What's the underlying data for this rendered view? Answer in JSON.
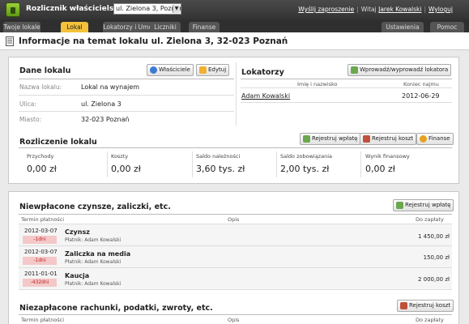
{
  "app": {
    "title": "Rozlicznik właścicielski dla",
    "property_select": "ul. Zielona 3, Poznań",
    "links": {
      "invites": "Wyślij zaproszenie",
      "greeting": "Witaj",
      "user": "Jarek Kowalski",
      "logout": "Wyloguj"
    }
  },
  "tabs": {
    "left": [
      "Twoje lokale",
      "Lokal",
      "Lokatorzy i Umowy",
      "Liczniki",
      "Finanse"
    ],
    "active": "Lokal",
    "right": [
      "Ustawienia",
      "Pomoc"
    ]
  },
  "page": {
    "title": "Informacje na temat lokalu ul. Zielona 3, 32-023 Poznań"
  },
  "dane_lokalu": {
    "title": "Dane lokalu",
    "btn_owners": "Właściciele",
    "btn_edit": "Edytuj",
    "fields": [
      {
        "label": "Nazwa lokalu:",
        "value": "Lokal na wynajem"
      },
      {
        "label": "Ulica:",
        "value": "ul. Zielona 3"
      },
      {
        "label": "Miasto:",
        "value": "32-023 Poznań"
      }
    ]
  },
  "lokatorzy": {
    "title": "Lokatorzy",
    "btn": "Wprowadź/wyprowadź lokatora",
    "col_name": "Imię i nazwisko",
    "col_end": "Koniec najmu",
    "rows": [
      {
        "name": "Adam Kowalski",
        "end": "2012-06-29"
      }
    ]
  },
  "rozliczenie": {
    "title": "Rozliczenie lokalu",
    "btn_payment": "Rejestruj wpłatę",
    "btn_cost": "Rejestruj koszt",
    "btn_finance": "Finanse",
    "stats": [
      {
        "label": "Przychody",
        "value": "0,00 zł"
      },
      {
        "label": "Koszty",
        "value": "0,00 zł"
      },
      {
        "label": "Saldo należności",
        "value": "3,60 tys. zł"
      },
      {
        "label": "Saldo zobowiązania",
        "value": "2,00 tys. zł"
      },
      {
        "label": "Wynik finansowy",
        "value": "0,00 zł"
      }
    ]
  },
  "niewplacone": {
    "title": "Niewpłacone czynsze, zaliczki, etc.",
    "btn": "Rejestruj wpłatę",
    "col_due": "Termin płatności",
    "col_desc": "Opis",
    "col_amount": "Do zapłaty",
    "rows": [
      {
        "date": "2012-03-07",
        "days": "-1dni",
        "title": "Czynsz",
        "payer": "Płatnik: Adam Kowalski",
        "amount": "1 450,00 zł"
      },
      {
        "date": "2012-03-07",
        "days": "-1dni",
        "title": "Zaliczka na media",
        "payer": "Płatnik: Adam Kowalski",
        "amount": "150,00 zł"
      },
      {
        "date": "2011-01-01",
        "days": "-432dni",
        "title": "Kaucja",
        "payer": "Płatnik: Adam Kowalski",
        "amount": "2 000,00 zł"
      }
    ]
  },
  "niezaplacone": {
    "title": "Niezapłacone rachunki, podatki, zwroty, etc.",
    "btn": "Rejestruj koszt",
    "col_due": "Termin płatności",
    "col_desc": "Opis",
    "col_amount": "Do zapłaty"
  }
}
